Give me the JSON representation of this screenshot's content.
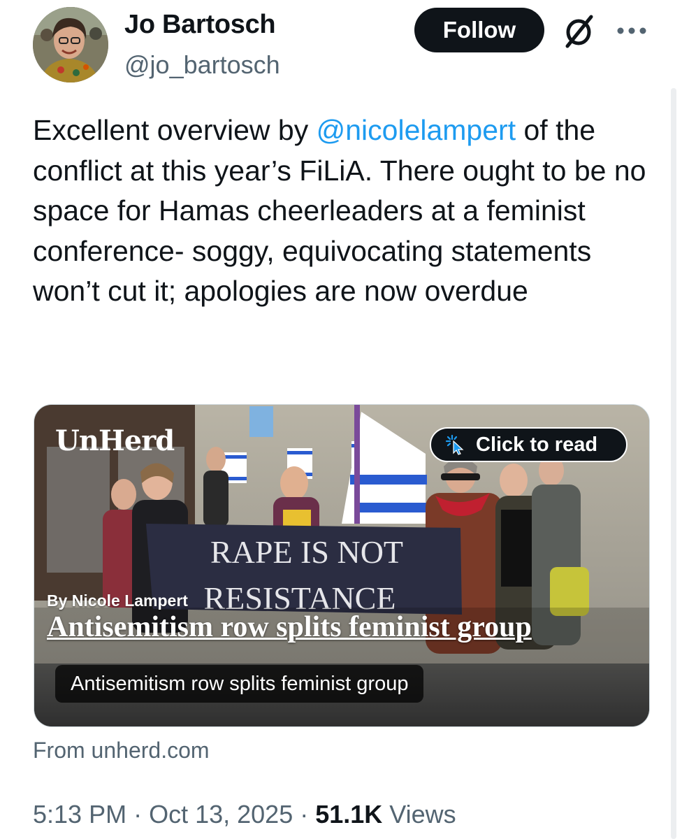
{
  "user": {
    "display_name": "Jo Bartosch",
    "handle": "@jo_bartosch"
  },
  "header": {
    "follow_label": "Follow"
  },
  "tweet": {
    "text_before": "Excellent overview by ",
    "mention": "@nicolelampert",
    "text_after": " of the conflict at this year’s FiLiA. There ought to be no space for Hamas cheerleaders at a feminist conference- soggy, equivocating statements won’t cut it; apologies are now overdue"
  },
  "card": {
    "brand": "UnHerd",
    "cta_label": "Click to read",
    "banner_line1": "RAPE IS NOT",
    "banner_line2": "RESISTANCE",
    "byline": "By Nicole Lampert",
    "headline": "Antisemitism row splits feminist group",
    "title": "Antisemitism row splits feminist group",
    "domain": "From unherd.com"
  },
  "meta": {
    "time": "5:13 PM",
    "separator": " · ",
    "date": "Oct 13, 2025",
    "views_count": "51.1K",
    "views_label": " Views"
  },
  "icons": {
    "grok": "grok-icon",
    "more": "more-horizontal-icon",
    "cursor": "cursor-click-icon"
  },
  "colors": {
    "accent": "#1d9bf0",
    "text": "#0f1419",
    "secondary": "#536471"
  }
}
